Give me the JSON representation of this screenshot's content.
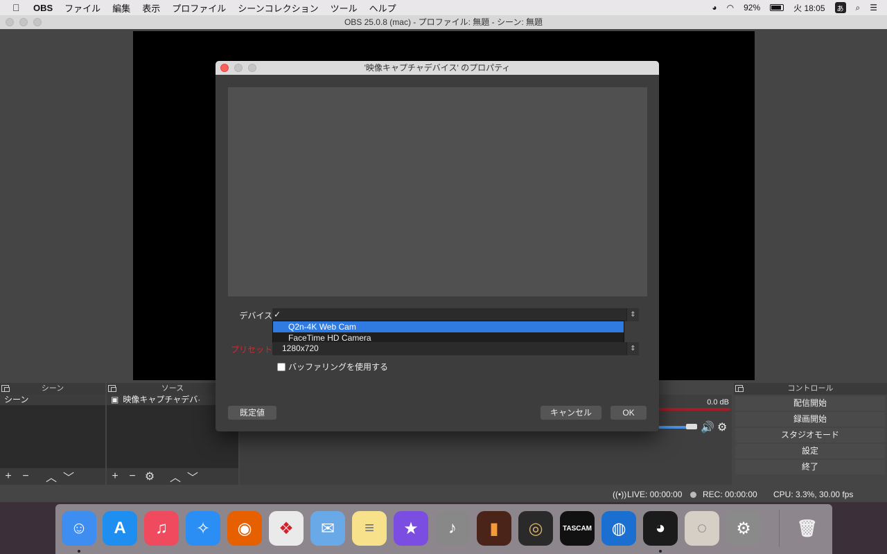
{
  "menubar": {
    "app": "OBS",
    "items": [
      "ファイル",
      "編集",
      "表示",
      "プロファイル",
      "シーンコレクション",
      "ツール",
      "ヘルプ"
    ],
    "battery": "92%",
    "clock": "火 18:05",
    "ime": "あ"
  },
  "window": {
    "title": "OBS 25.0.8 (mac) - プロファイル: 無題 - シーン: 無題"
  },
  "docks": {
    "scenes_title": "シーン",
    "sources_title": "ソース",
    "controls_title": "コントロール"
  },
  "scenes": {
    "items": [
      "シーン"
    ]
  },
  "sources": {
    "items": [
      "映像キャプチャデバ·"
    ]
  },
  "mixer": {
    "level": "0.0 dB"
  },
  "controls": {
    "buttons": [
      "配信開始",
      "録画開始",
      "スタジオモード",
      "設定",
      "終了"
    ]
  },
  "status": {
    "live": "LIVE: 00:00:00",
    "rec": "REC: 00:00:00",
    "cpu": "CPU: 3.3%, 30.00 fps"
  },
  "dialog": {
    "title": "'映像キャプチャデバイス' のプロパティ",
    "device_label": "デバイス",
    "device_value": "✓",
    "device_options": [
      "Q2n-4K Web Cam",
      "FaceTime HD Camera"
    ],
    "preset_label": "プリセット",
    "preset_value": "1280x720",
    "buffering_label": "バッファリングを使用する",
    "buttons": {
      "defaults": "既定値",
      "cancel": "キャンセル",
      "ok": "OK"
    }
  },
  "dock_apps": [
    {
      "name": "Finder",
      "color": "#3d8ef0",
      "glyph": "☺"
    },
    {
      "name": "App Store",
      "color": "#1f8ef1",
      "glyph": "A"
    },
    {
      "name": "Music",
      "color": "#f04a5e",
      "glyph": "♫"
    },
    {
      "name": "Safari",
      "color": "#2a8ef5",
      "glyph": "✧"
    },
    {
      "name": "Firefox",
      "color": "#e66000",
      "glyph": "◉"
    },
    {
      "name": "Creative Cloud",
      "color": "#eaeaea",
      "glyph": "❖"
    },
    {
      "name": "Mail",
      "color": "#6aa9e8",
      "glyph": "✉"
    },
    {
      "name": "Notes",
      "color": "#f7e28b",
      "glyph": "≡"
    },
    {
      "name": "iMovie",
      "color": "#7b4de0",
      "glyph": "★"
    },
    {
      "name": "Logic",
      "color": "#888",
      "glyph": "♪"
    },
    {
      "name": "Vintage Tube",
      "color": "#4a2418",
      "glyph": "▮"
    },
    {
      "name": "Audio Plugin",
      "color": "#2a2a2a",
      "glyph": "◎"
    },
    {
      "name": "TASCAM",
      "color": "#111",
      "glyph": "TASCAM"
    },
    {
      "name": "Audio App",
      "color": "#1a6fd0",
      "glyph": "◍"
    },
    {
      "name": "OBS",
      "color": "#1b1b1b",
      "glyph": "◕"
    },
    {
      "name": "Microphone",
      "color": "#d6cfc5",
      "glyph": "◌"
    },
    {
      "name": "System Preferences",
      "color": "#8a8a8a",
      "glyph": "⚙"
    }
  ],
  "trash": {
    "name": "Trash",
    "glyph": "🗑"
  }
}
